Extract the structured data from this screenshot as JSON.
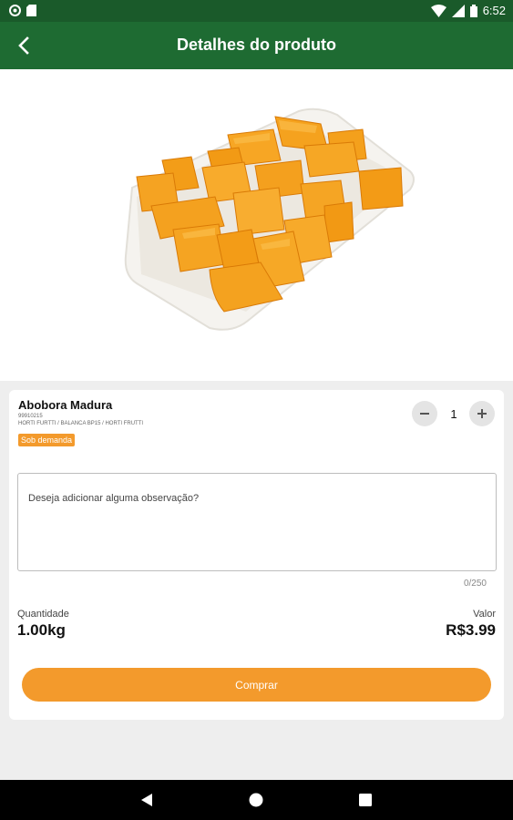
{
  "status_bar": {
    "time": "6:52",
    "icons": [
      "notification-circle-icon",
      "sd-card-icon",
      "wifi-icon",
      "cell-signal-icon",
      "battery-icon"
    ]
  },
  "app_bar": {
    "title": "Detalhes do produto",
    "back_icon": "back-arrow-icon",
    "color": "#1e6b32"
  },
  "product": {
    "image_subject": "pumpkin-cubes-tray",
    "name": "Abobora Madura",
    "code": "99910215",
    "category": "HORTI FURTTI / BALANCA BP15 / HORTI FRUTTI",
    "badge": "Sob demanda",
    "quantity_counter": "1"
  },
  "observation": {
    "placeholder": "Deseja adicionar alguma observação?",
    "value": "",
    "char_count": "0/250"
  },
  "summary": {
    "quantity_label": "Quantidade",
    "quantity_value": "1.00kg",
    "value_label": "Valor",
    "value_amount": "R$3.99"
  },
  "buy_button": {
    "label": "Comprar",
    "color": "#f39a2c"
  },
  "nav_bar": {
    "buttons": [
      "back-triangle-icon",
      "home-circle-icon",
      "recents-square-icon"
    ]
  }
}
